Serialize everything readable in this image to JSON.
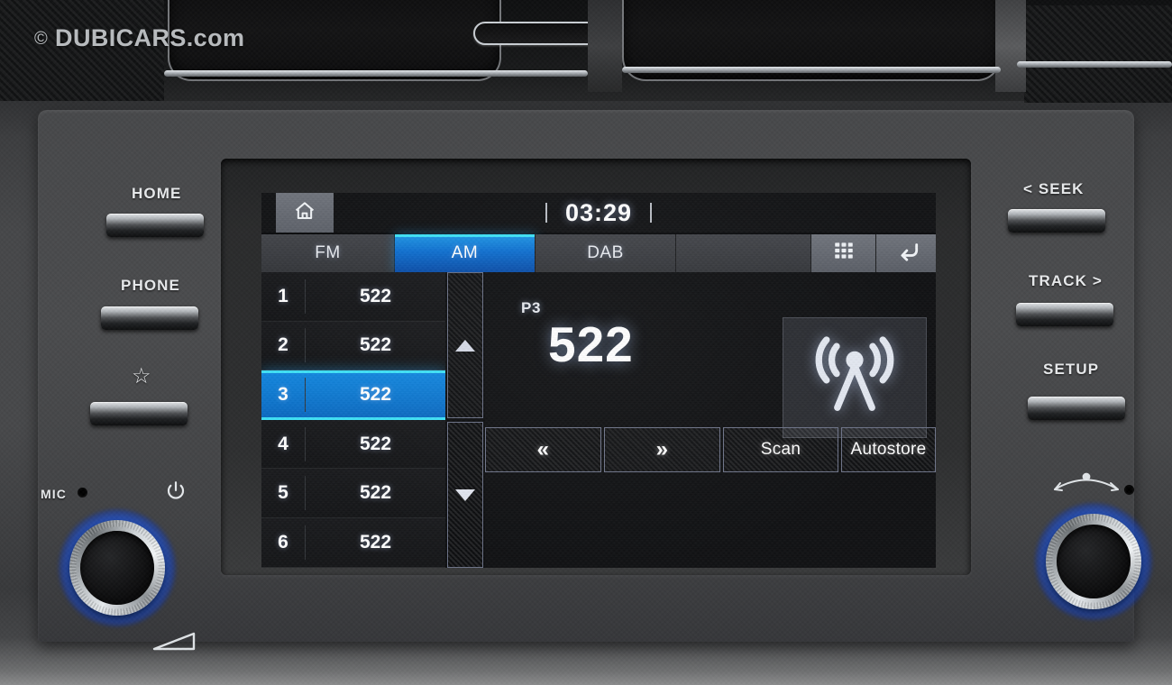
{
  "watermark": {
    "copyright": "©",
    "text": "DUBICARS.com"
  },
  "screen": {
    "status": {
      "clock": "03:29",
      "home_icon": "home-icon"
    },
    "tabs": [
      {
        "label": "FM",
        "active": false
      },
      {
        "label": "AM",
        "active": true
      },
      {
        "label": "DAB",
        "active": false
      },
      {
        "label": "",
        "active": false
      }
    ],
    "tab_icons": [
      {
        "name": "grid-apps-icon"
      },
      {
        "name": "back-return-icon"
      }
    ],
    "presets": {
      "header": "",
      "rows": [
        {
          "num": "1",
          "freq": "522",
          "selected": false
        },
        {
          "num": "2",
          "freq": "522",
          "selected": false
        },
        {
          "num": "3",
          "freq": "522",
          "selected": true
        },
        {
          "num": "4",
          "freq": "522",
          "selected": false
        },
        {
          "num": "5",
          "freq": "522",
          "selected": false
        },
        {
          "num": "6",
          "freq": "522",
          "selected": false
        }
      ]
    },
    "now_playing": {
      "preset_tag": "P3",
      "frequency": "522",
      "band_icon": "radio-antenna-icon"
    },
    "controls": [
      {
        "label": "«",
        "name": "tune-down-button"
      },
      {
        "label": "»",
        "name": "tune-up-button"
      },
      {
        "label": "Scan",
        "name": "scan-button"
      },
      {
        "label": "Autostore",
        "name": "autostore-button"
      }
    ],
    "colors": {
      "accent_blue": "#0e6fd0",
      "accent_cyan": "#3fe2f7",
      "button_lilac": "#8d94a8",
      "screen_black": "#0a0b0d"
    }
  },
  "hardware": {
    "left_buttons": [
      {
        "label": "HOME",
        "name": "home-hard-key"
      },
      {
        "label": "PHONE",
        "name": "phone-hard-key"
      },
      {
        "label": "☆",
        "name": "favorite-hard-key"
      }
    ],
    "right_buttons": [
      {
        "label": "< SEEK",
        "name": "seek-hard-key"
      },
      {
        "label": "TRACK >",
        "name": "track-hard-key"
      },
      {
        "label": "SETUP",
        "name": "setup-hard-key"
      }
    ],
    "left_knob": {
      "mic_label": "MIC",
      "power_icon": "power-icon",
      "volume_icon": "volume-icon",
      "name": "volume-power-knob"
    },
    "right_knob": {
      "tune_icon": "tune-rotate-icon",
      "name": "tune-knob"
    }
  }
}
